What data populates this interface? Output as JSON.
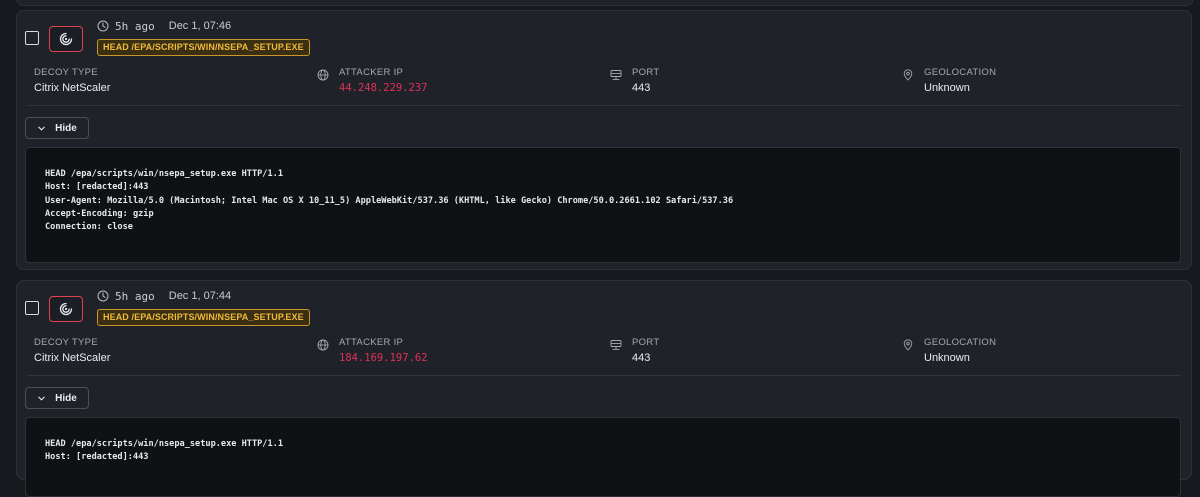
{
  "events": [
    {
      "relative_time": "5h ago",
      "timestamp": "Dec 1, 07:46",
      "request_path": "HEAD /EPA/SCRIPTS/WIN/NSEPA_SETUP.EXE",
      "fields": [
        {
          "label": "DECOY TYPE",
          "value": "Citrix NetScaler",
          "icon": "none"
        },
        {
          "label": "ATTACKER IP",
          "value": "44.248.229.237",
          "icon": "globe-icon"
        },
        {
          "label": "PORT",
          "value": "443",
          "icon": "server-icon"
        },
        {
          "label": "GEOLOCATION",
          "value": "Unknown",
          "icon": "map-pin-icon"
        }
      ],
      "toggle_label": "Hide",
      "raw_request": [
        "HEAD /epa/scripts/win/nsepa_setup.exe HTTP/1.1",
        "Host: [redacted]:443",
        "User-Agent: Mozilla/5.0 (Macintosh; Intel Mac OS X 10_11_5) AppleWebKit/537.36 (KHTML, like Gecko) Chrome/50.0.2661.102 Safari/537.36",
        "Accept-Encoding: gzip",
        "Connection: close"
      ]
    },
    {
      "relative_time": "5h ago",
      "timestamp": "Dec 1, 07:44",
      "request_path": "HEAD /EPA/SCRIPTS/WIN/NSEPA_SETUP.EXE",
      "fields": [
        {
          "label": "DECOY TYPE",
          "value": "Citrix NetScaler",
          "icon": "none"
        },
        {
          "label": "ATTACKER IP",
          "value": "184.169.197.62",
          "icon": "globe-icon"
        },
        {
          "label": "PORT",
          "value": "443",
          "icon": "server-icon"
        },
        {
          "label": "GEOLOCATION",
          "value": "Unknown",
          "icon": "map-pin-icon"
        }
      ],
      "toggle_label": "Hide",
      "raw_request": [
        "HEAD /epa/scripts/win/nsepa_setup.exe HTTP/1.1",
        "Host: [redacted]:443"
      ]
    }
  ],
  "colors": {
    "background": "#16191e",
    "card": "#1f2329",
    "attacker_ip": "#e0305a",
    "badge_text": "#f0b93a",
    "decoy_icon_border": "#e0414f"
  }
}
